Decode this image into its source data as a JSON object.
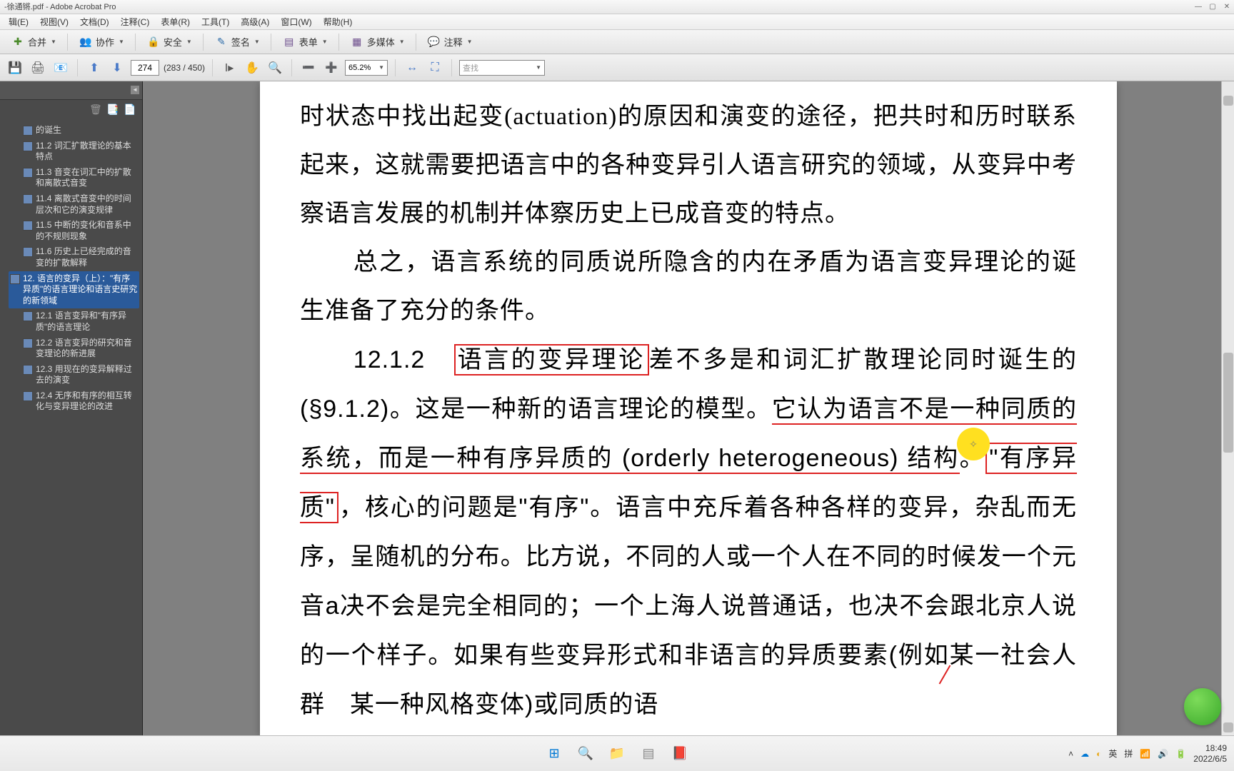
{
  "window": {
    "title": "-徐通锵.pdf - Adobe Acrobat Pro"
  },
  "menu": {
    "m1": "辑(E)",
    "m2": "视图(V)",
    "m3": "文档(D)",
    "m4": "注释(C)",
    "m5": "表单(R)",
    "m6": "工具(T)",
    "m7": "高级(A)",
    "m8": "窗口(W)",
    "m9": "帮助(H)"
  },
  "toolbar": {
    "merge": "合并",
    "collab": "协作",
    "secure": "安全",
    "sign": "签名",
    "forms": "表单",
    "multimedia": "多媒体",
    "comment": "注释"
  },
  "nav": {
    "page_current": "274",
    "page_total": "(283 / 450)",
    "zoom": "65.2%",
    "find": "查找"
  },
  "bookmarks": {
    "b0": "的诞生",
    "b1": "11.2 词汇扩散理论的基本特点",
    "b2": "11.3 音变在词汇中的扩散和离散式音变",
    "b3": "11.4 离散式音变中的时间层次和它的演变规律",
    "b4": "11.5 中断的变化和音系中的不规则现象",
    "b5": "11.6 历史上已经完成的音变的扩散解释",
    "b6": "12. 语言的变异（上）：\"有序异质\"的语言理论和语言史研究的新领域",
    "b7": "12.1 语言变异和\"有序异质\"的语言理论",
    "b8": "12.2 语言变异的研究和音变理论的新进展",
    "b9": "12.3 用现在的变异解释过去的演变",
    "b10": "12.4 无序和有序的相互转化与变异理论的改进"
  },
  "doc": {
    "p1": "时状态中找出起变(actuation)的原因和演变的途径，把共时和历时联系起来，这就需要把语言中的各种变异引人语言研究的领域，从变异中考察语言发展的机制并体察历史上已成音变的特点。",
    "p2": "总之，语言系统的同质说所隐含的内在矛盾为语言变异理论的诞生准备了充分的条件。",
    "p3_a": "12.1.2　",
    "p3_box1": "语言的变异理论",
    "p3_b": "差不多是和词汇扩散理论同时诞生的(§9.1.2)。这是一种新的语言理论的模型。",
    "p3_ul1": "它认为语言不是一种同质的系统，而是一种有序异质的 (orderly heterogeneous) 结构",
    "p3_c": "。",
    "p3_box2": "\"有序异质\"",
    "p3_d": "，核心的问题是\"有序\"。语言中充斥着各种各样的变异，杂乱而无序，呈随机的分布。比方说，不同的人或一个人在不同的时候发一个元音a决不会是完全相同的；一个上海人说普通话，也决不会跟北京人说的一个样子。如果有些变异形式和非语言的异质要素(例如某一社会人群　某一种风格变体)或同质的语"
  },
  "tray": {
    "ime1": "英",
    "ime2": "拼",
    "time": "18:49",
    "date": "2022/6/5"
  }
}
